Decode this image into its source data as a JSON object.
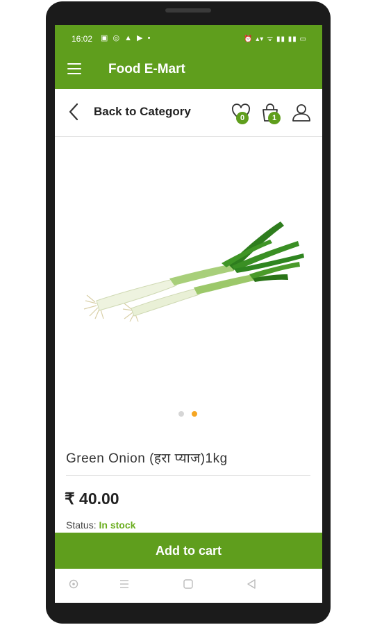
{
  "status_bar": {
    "time": "16:02",
    "left_icons": "▣ ◎ ▲ ▶ •",
    "right_icons": "⏰ ▴▾ ᯤ ▮▮ ▮▮ ▭"
  },
  "app_bar": {
    "title": "Food E-Mart",
    "menu_icon": "hamburger-icon"
  },
  "nav": {
    "back_label": "Back to Category",
    "wishlist_count": "0",
    "cart_count": "1",
    "icons": [
      "chevron-left-icon",
      "heart-icon",
      "shopping-bag-icon",
      "user-icon"
    ]
  },
  "carousel": {
    "total_slides": 2,
    "active_index": 1,
    "active_color": "#f5a623",
    "inactive_color": "#d6d6d6"
  },
  "product": {
    "name": "Green Onion (हरा प्याज)1kg",
    "price": "₹ 40.00",
    "status_label": "Status:",
    "status_value": "In stock"
  },
  "actions": {
    "add_to_cart": "Add to cart"
  },
  "system_nav": {
    "icons": [
      "circle-icon",
      "recent-apps-icon",
      "home-icon",
      "back-triangle-icon"
    ]
  },
  "colors": {
    "primary": "#5f9e1d",
    "in_stock": "#6aad1e"
  }
}
